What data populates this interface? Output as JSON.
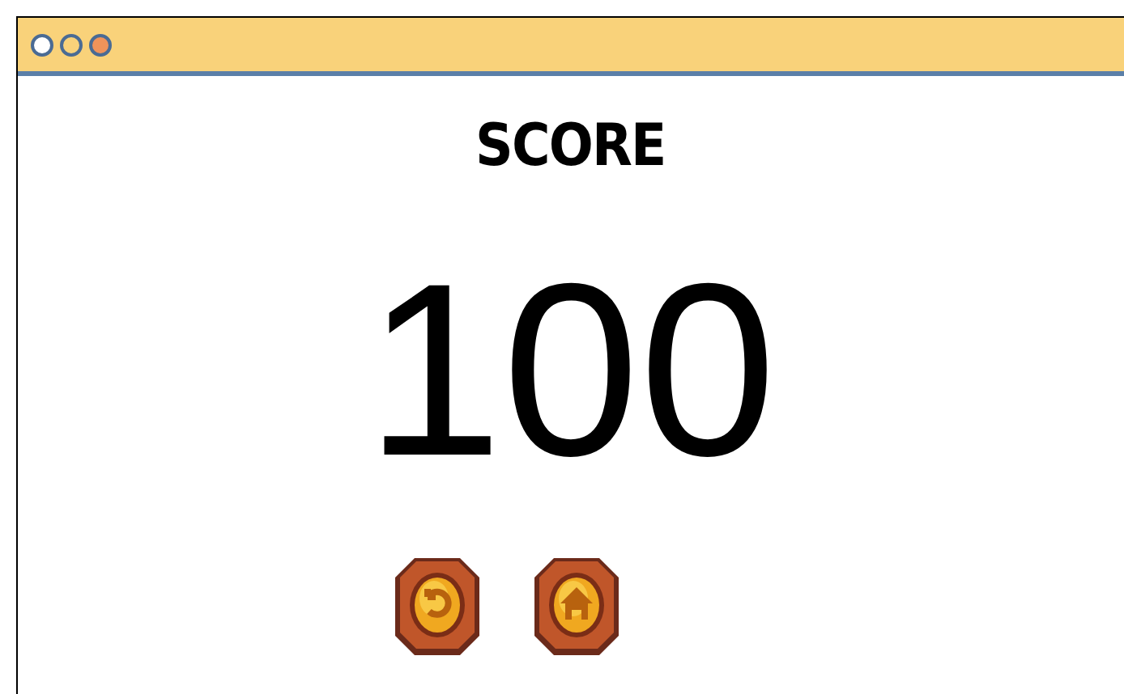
{
  "window": {
    "dots": [
      {
        "color": "#ffffff"
      },
      {
        "color": "#f9d27a"
      },
      {
        "color": "#f0935a"
      }
    ]
  },
  "heading": "SCORE",
  "score": "100",
  "buttons": [
    {
      "kind": "restart"
    },
    {
      "kind": "home"
    }
  ]
}
